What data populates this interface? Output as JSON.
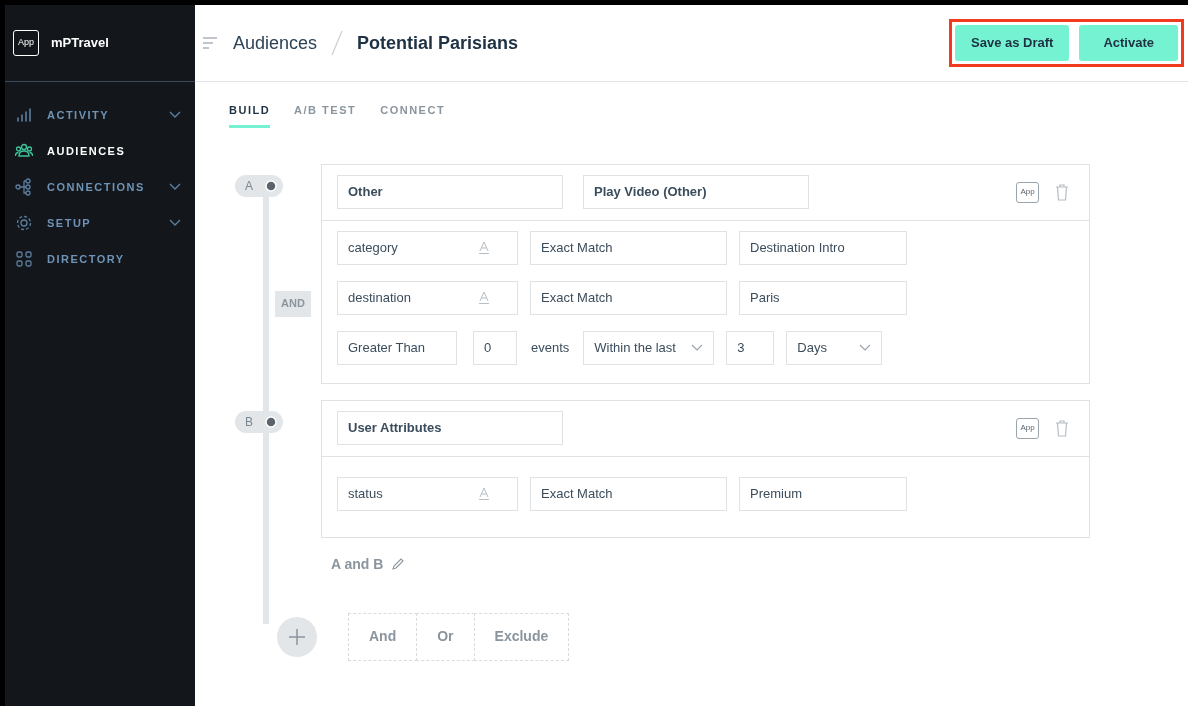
{
  "app": {
    "badge": "App",
    "name": "mPTravel"
  },
  "sidebar": {
    "items": [
      {
        "label": "ACTIVITY",
        "selected": false,
        "expandable": true
      },
      {
        "label": "AUDIENCES",
        "selected": true,
        "expandable": false
      },
      {
        "label": "CONNECTIONS",
        "selected": false,
        "expandable": true
      },
      {
        "label": "SETUP",
        "selected": false,
        "expandable": true
      },
      {
        "label": "DIRECTORY",
        "selected": false,
        "expandable": false
      }
    ]
  },
  "breadcrumb": [
    "Audiences",
    "Potential Parisians"
  ],
  "actions": {
    "highlighted": true,
    "buttons": [
      "Save as Draft",
      "Activate"
    ]
  },
  "tabs": [
    {
      "label": "BUILD",
      "selected": true
    },
    {
      "label": "A/B TEST",
      "selected": false
    },
    {
      "label": "CONNECT",
      "selected": false
    }
  ],
  "criteria": [
    {
      "letter": "A",
      "header": [
        "Other",
        "Play Video (Other)"
      ],
      "platform": "App",
      "rows": [
        {
          "kind": "attribute",
          "attribute": "category",
          "operator": "Exact Match",
          "value": "Destination Intro"
        },
        {
          "kind": "attribute",
          "attribute": "destination",
          "operator": "Exact Match",
          "value": "Paris"
        },
        {
          "kind": "frequency",
          "comparison": "Greater Than",
          "count": "0",
          "unit": "events",
          "window": "Within the last",
          "amount": "3",
          "period": "Days"
        }
      ]
    },
    {
      "letter": "B",
      "header": [
        "User Attributes"
      ],
      "platform": "App",
      "rows": [
        {
          "kind": "attribute",
          "attribute": "status",
          "operator": "Exact Match",
          "value": "Premium"
        }
      ]
    }
  ],
  "joiner": "AND",
  "expression": "A and B",
  "add_options": [
    "And",
    "Or",
    "Exclude"
  ]
}
